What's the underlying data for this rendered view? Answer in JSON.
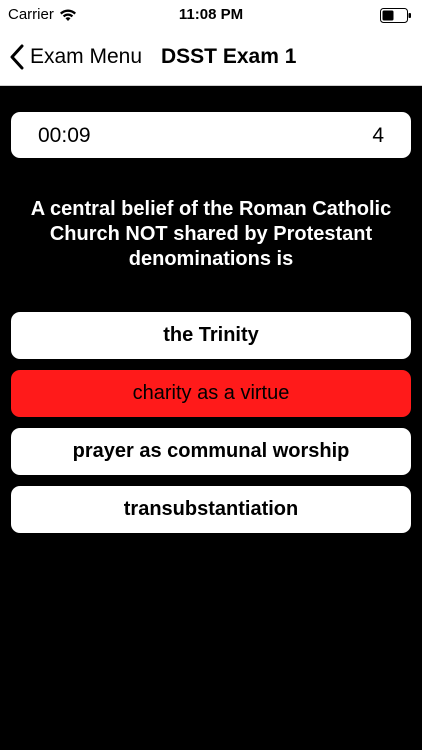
{
  "status_bar": {
    "carrier": "Carrier",
    "time": "11:08 PM",
    "wifi_icon": "wifi-icon",
    "battery_icon": "battery-icon"
  },
  "nav": {
    "back_label": "Exam Menu",
    "back_icon": "chevron-left-icon",
    "title": "DSST Exam 1"
  },
  "quiz": {
    "timer": "00:09",
    "question_number": "4",
    "question": "A central belief of the Roman Catholic Church NOT shared by Protestant denominations is",
    "answers": [
      {
        "label": "the Trinity",
        "state": "default"
      },
      {
        "label": "charity as a virtue",
        "state": "selected-wrong"
      },
      {
        "label": "prayer as communal worship",
        "state": "default"
      },
      {
        "label": "transubstantiation",
        "state": "default"
      }
    ]
  },
  "colors": {
    "background": "#000000",
    "card": "#ffffff",
    "wrong_answer": "#ff1a1a"
  }
}
